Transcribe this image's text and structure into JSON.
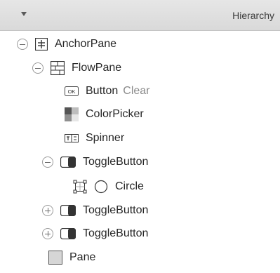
{
  "panel": {
    "title": "Hierarchy"
  },
  "tree": [
    {
      "label": "AnchorPane",
      "icon": "anchor-pane-icon",
      "toggle": "collapse"
    },
    {
      "label": "FlowPane",
      "icon": "flow-pane-icon",
      "toggle": "collapse"
    },
    {
      "label": "Button",
      "sub": "Clear",
      "icon": "button-icon",
      "badge": "OK"
    },
    {
      "label": "ColorPicker",
      "icon": "color-picker-icon"
    },
    {
      "label": "Spinner",
      "icon": "spinner-icon"
    },
    {
      "label": "ToggleButton",
      "icon": "toggle-button-icon",
      "toggle": "collapse"
    },
    {
      "label": "Circle",
      "icon": "circle-icon",
      "extra_icon": "graphic-slot-icon"
    },
    {
      "label": "ToggleButton",
      "icon": "toggle-button-icon",
      "toggle": "expand"
    },
    {
      "label": "ToggleButton",
      "icon": "toggle-button-icon",
      "toggle": "expand"
    },
    {
      "label": "Pane",
      "icon": "pane-icon"
    }
  ],
  "colors": {
    "header_bg": "#dedede",
    "text": "#262626",
    "secondary_text": "#8a8a8a"
  }
}
